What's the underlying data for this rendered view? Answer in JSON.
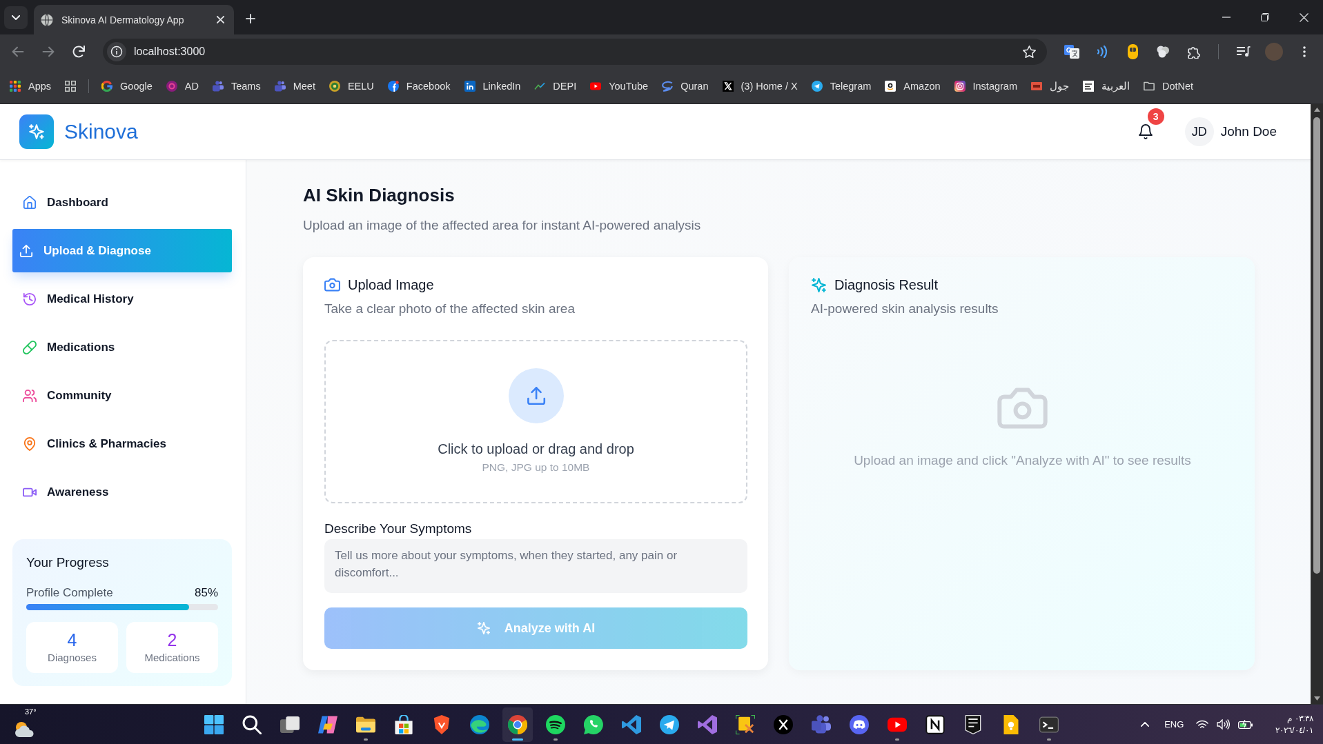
{
  "browser": {
    "tabs": [
      {
        "title": "Skinova AI Dermatology App",
        "selected": true
      }
    ],
    "address": "localhost:3000",
    "bookmarks": [
      {
        "label": "Apps"
      },
      {
        "label": "Google"
      },
      {
        "label": "AD"
      },
      {
        "label": "Teams"
      },
      {
        "label": "Meet"
      },
      {
        "label": "EELU"
      },
      {
        "label": "Facebook"
      },
      {
        "label": "LinkedIn"
      },
      {
        "label": "DEPI"
      },
      {
        "label": "YouTube"
      },
      {
        "label": "Quran"
      },
      {
        "label": "(3) Home / X"
      },
      {
        "label": "Telegram"
      },
      {
        "label": "Amazon"
      },
      {
        "label": "Instagram"
      },
      {
        "label": "جول"
      },
      {
        "label": "العربية"
      },
      {
        "label": "DotNet"
      }
    ]
  },
  "header": {
    "brand": "Skinova",
    "notification_count": "3",
    "user": {
      "initials": "JD",
      "name": "John Doe"
    }
  },
  "sidebar": {
    "items": [
      {
        "label": "Dashboard",
        "selected": false
      },
      {
        "label": "Upload & Diagnose",
        "selected": true
      },
      {
        "label": "Medical History",
        "selected": false
      },
      {
        "label": "Medications",
        "selected": false
      },
      {
        "label": "Community",
        "selected": false
      },
      {
        "label": "Clinics & Pharmacies",
        "selected": false
      },
      {
        "label": "Awareness",
        "selected": false
      }
    ],
    "progress": {
      "title": "Your Progress",
      "label": "Profile Complete",
      "reading": "85%",
      "level": 0.85,
      "stats": [
        {
          "value": "4",
          "label": "Diagnoses",
          "color": "#2563eb"
        },
        {
          "value": "2",
          "label": "Medications",
          "color": "#9333ea"
        }
      ]
    }
  },
  "main": {
    "title": "AI Skin Diagnosis",
    "subtitle": "Upload an image of the affected area for instant AI-powered analysis",
    "upload_card": {
      "title": "Upload Image",
      "subtitle": "Take a clear photo of the affected skin area",
      "dropzone": {
        "text": "Click to upload or drag and drop",
        "hint": "PNG, JPG up to 10MB"
      },
      "symptoms": {
        "label": "Describe Your Symptoms",
        "placeholder": "Tell us more about your symptoms, when they started, any pain or discomfort..."
      },
      "analyze_button": {
        "label": "Analyze with AI",
        "disabled": true
      }
    },
    "result_card": {
      "title": "Diagnosis Result",
      "subtitle": "AI-powered skin analysis results",
      "empty_text": "Upload an image and click \"Analyze with AI\" to see results"
    }
  },
  "taskbar": {
    "weather": "37°",
    "apps": [
      {
        "running": false,
        "selected": false
      },
      {
        "running": false,
        "selected": false
      },
      {
        "running": false,
        "selected": false
      },
      {
        "running": false,
        "selected": false
      },
      {
        "running": true,
        "selected": false
      },
      {
        "running": false,
        "selected": false
      },
      {
        "running": false,
        "selected": false
      },
      {
        "running": false,
        "selected": false
      },
      {
        "running": true,
        "selected": true
      },
      {
        "running": true,
        "selected": false
      },
      {
        "running": false,
        "selected": false
      },
      {
        "running": false,
        "selected": false
      },
      {
        "running": false,
        "selected": false
      },
      {
        "running": false,
        "selected": false
      },
      {
        "running": false,
        "selected": false
      },
      {
        "running": false,
        "selected": false
      },
      {
        "running": false,
        "selected": false
      },
      {
        "running": false,
        "selected": false
      },
      {
        "running": true,
        "selected": false
      },
      {
        "running": false,
        "selected": false
      },
      {
        "running": false,
        "selected": false
      },
      {
        "running": false,
        "selected": false
      },
      {
        "running": true,
        "selected": false
      }
    ],
    "language": "ENG",
    "time": "٠٣:٣٨ م",
    "date": "٢٠٢٦/٠٤/٠١"
  }
}
